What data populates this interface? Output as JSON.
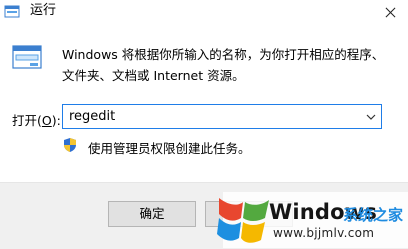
{
  "window": {
    "title": "运行"
  },
  "description": {
    "line1": "Windows 将根据你所输入的名称，为你打开相应的程序、",
    "line2": "文件夹、文档或 Internet 资源。"
  },
  "open": {
    "label_prefix": "打开(",
    "label_hotkey": "O",
    "label_suffix": "):",
    "value": "regedit"
  },
  "admin_note": "使用管理员权限创建此任务。",
  "buttons": {
    "ok": "确定"
  },
  "watermark": {
    "brand_en": "Windows",
    "brand_cn": "系统之家",
    "url": "www.bjjmlv.com"
  },
  "colors": {
    "input_border": "#1f7de8",
    "footer_bg": "#f0f0f0",
    "watermark_cn": "#1e8be0"
  },
  "icons": {
    "title": "run-dialog-icon",
    "header": "run-dialog-icon",
    "dropdown": "chevron-down-icon",
    "admin": "uac-shield-icon",
    "close": "close-icon"
  }
}
